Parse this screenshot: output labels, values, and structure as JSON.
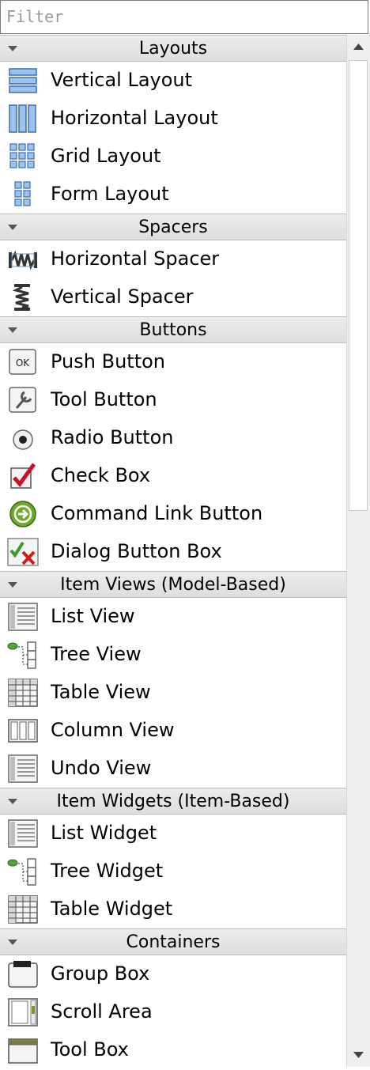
{
  "filter": {
    "placeholder": "Filter"
  },
  "categories": [
    {
      "title": "Layouts",
      "items": [
        {
          "label": "Vertical Layout",
          "icon": "vertical-layout-icon"
        },
        {
          "label": "Horizontal Layout",
          "icon": "horizontal-layout-icon"
        },
        {
          "label": "Grid Layout",
          "icon": "grid-layout-icon"
        },
        {
          "label": "Form Layout",
          "icon": "form-layout-icon"
        }
      ]
    },
    {
      "title": "Spacers",
      "items": [
        {
          "label": "Horizontal Spacer",
          "icon": "horizontal-spacer-icon"
        },
        {
          "label": "Vertical Spacer",
          "icon": "vertical-spacer-icon"
        }
      ]
    },
    {
      "title": "Buttons",
      "items": [
        {
          "label": "Push Button",
          "icon": "push-button-icon"
        },
        {
          "label": "Tool Button",
          "icon": "tool-button-icon"
        },
        {
          "label": "Radio Button",
          "icon": "radio-button-icon"
        },
        {
          "label": "Check Box",
          "icon": "check-box-icon"
        },
        {
          "label": "Command Link Button",
          "icon": "command-link-icon"
        },
        {
          "label": "Dialog Button Box",
          "icon": "dialog-button-box-icon"
        }
      ]
    },
    {
      "title": "Item Views (Model-Based)",
      "items": [
        {
          "label": "List View",
          "icon": "list-view-icon"
        },
        {
          "label": "Tree View",
          "icon": "tree-view-icon"
        },
        {
          "label": "Table View",
          "icon": "table-view-icon"
        },
        {
          "label": "Column View",
          "icon": "column-view-icon"
        },
        {
          "label": "Undo View",
          "icon": "undo-view-icon"
        }
      ]
    },
    {
      "title": "Item Widgets (Item-Based)",
      "items": [
        {
          "label": "List Widget",
          "icon": "list-widget-icon"
        },
        {
          "label": "Tree Widget",
          "icon": "tree-widget-icon"
        },
        {
          "label": "Table Widget",
          "icon": "table-widget-icon"
        }
      ]
    },
    {
      "title": "Containers",
      "items": [
        {
          "label": "Group Box",
          "icon": "group-box-icon"
        },
        {
          "label": "Scroll Area",
          "icon": "scroll-area-icon"
        },
        {
          "label": "Tool Box",
          "icon": "tool-box-icon"
        }
      ]
    }
  ],
  "scrollbar": {
    "thumb_position": 0
  }
}
